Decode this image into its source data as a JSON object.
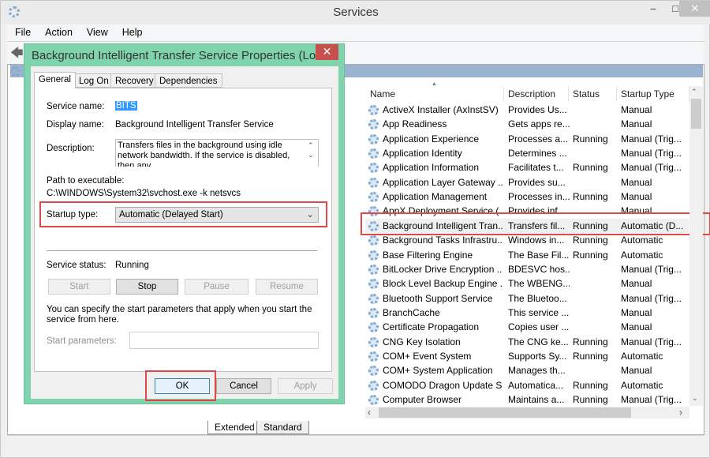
{
  "window": {
    "title": "Services"
  },
  "menu": [
    "File",
    "Action",
    "View",
    "Help"
  ],
  "columns": [
    "Name",
    "Description",
    "Status",
    "Startup Type"
  ],
  "services": [
    [
      "ActiveX Installer (AxInstSV)",
      "Provides Us...",
      "",
      "Manual"
    ],
    [
      "App Readiness",
      "Gets apps re...",
      "",
      "Manual"
    ],
    [
      "Application Experience",
      "Processes a...",
      "Running",
      "Manual (Trig..."
    ],
    [
      "Application Identity",
      "Determines ...",
      "",
      "Manual (Trig..."
    ],
    [
      "Application Information",
      "Facilitates t...",
      "Running",
      "Manual (Trig..."
    ],
    [
      "Application Layer Gateway ...",
      "Provides su...",
      "",
      "Manual"
    ],
    [
      "Application Management",
      "Processes in...",
      "Running",
      "Manual"
    ],
    [
      "AppX Deployment Service (...",
      "Provides inf...",
      "",
      "Manual"
    ],
    [
      "Background Intelligent Tran...",
      "Transfers fil...",
      "Running",
      "Automatic (D..."
    ],
    [
      "Background Tasks Infrastru...",
      "Windows in...",
      "Running",
      "Automatic"
    ],
    [
      "Base Filtering Engine",
      "The Base Fil...",
      "Running",
      "Automatic"
    ],
    [
      "BitLocker Drive Encryption ...",
      "BDESVC hos...",
      "",
      "Manual (Trig..."
    ],
    [
      "Block Level Backup Engine ...",
      "The WBENG...",
      "",
      "Manual"
    ],
    [
      "Bluetooth Support Service",
      "The Bluetoo...",
      "",
      "Manual (Trig..."
    ],
    [
      "BranchCache",
      "This service ...",
      "",
      "Manual"
    ],
    [
      "Certificate Propagation",
      "Copies user ...",
      "",
      "Manual"
    ],
    [
      "CNG Key Isolation",
      "The CNG ke...",
      "Running",
      "Manual (Trig..."
    ],
    [
      "COM+ Event System",
      "Supports Sy...",
      "Running",
      "Automatic"
    ],
    [
      "COM+ System Application",
      "Manages th...",
      "",
      "Manual"
    ],
    [
      "COMODO Dragon Update S...",
      "Automatica...",
      "Running",
      "Automatic"
    ],
    [
      "Computer Browser",
      "Maintains a...",
      "Running",
      "Manual (Trig..."
    ]
  ],
  "view_tabs": [
    "Extended",
    "Standard"
  ],
  "dialog": {
    "title": "Background Intelligent Transfer Service Properties (Loc...",
    "tabs": [
      "General",
      "Log On",
      "Recovery",
      "Dependencies"
    ],
    "service_name_label": "Service name:",
    "service_name": "BITS",
    "display_name_label": "Display name:",
    "display_name": "Background Intelligent Transfer Service",
    "description_label": "Description:",
    "description": "Transfers files in the background using idle network bandwidth. If the service is disabled, then any",
    "path_label": "Path to executable:",
    "path": "C:\\WINDOWS\\System32\\svchost.exe -k netsvcs",
    "startup_type_label": "Startup type:",
    "startup_type": "Automatic (Delayed Start)",
    "status_label": "Service status:",
    "status": "Running",
    "buttons": {
      "start": "Start",
      "stop": "Stop",
      "pause": "Pause",
      "resume": "Resume",
      "ok": "OK",
      "cancel": "Cancel",
      "apply": "Apply"
    },
    "params_hint": "You can specify the start parameters that apply when you start the service from here.",
    "params_label": "Start parameters:",
    "params_value": ""
  },
  "colors": {
    "dialog_border": "#7fd4ae",
    "highlight": "#e04848",
    "header_band": "#9ab3d1"
  }
}
